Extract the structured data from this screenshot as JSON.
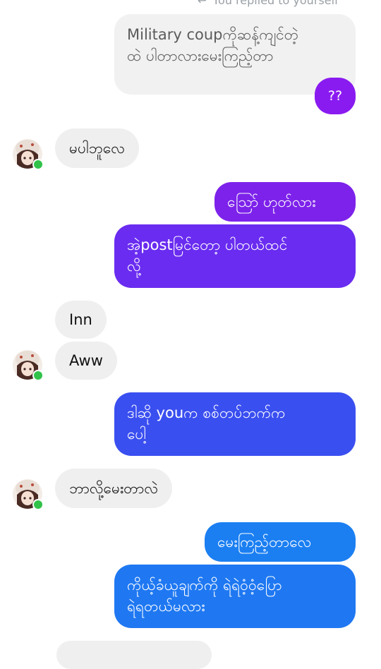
{
  "reply_hint": {
    "text": "You replied to yourself",
    "icon": "reply-arrow-icon"
  },
  "colors": {
    "purple_dark": "#7a1ee6",
    "purple_mid": "#6a2cf0",
    "blue": "#3a4ff0",
    "blue_light": "#1f78f2",
    "incoming": "#efefef",
    "online": "#31c24a"
  },
  "messages": [
    {
      "id": "quoted",
      "side": "right",
      "text_lines": [
        "Military coupကိုဆန့်ကျင်တဲ့",
        "ထဲ ပါတာလားမေးကြည့်တာ"
      ]
    },
    {
      "id": "qq",
      "side": "right",
      "text": "??"
    },
    {
      "id": "in1",
      "side": "left",
      "text": "မပါဘူလေ"
    },
    {
      "id": "out1",
      "side": "right",
      "text": "သြော် ဟုတ်လား"
    },
    {
      "id": "out2",
      "side": "right",
      "text_lines": [
        "အဲ့postမြင်တော့ ပါတယ်ထင်",
        "လို့"
      ]
    },
    {
      "id": "in2",
      "side": "left",
      "text": "Inn"
    },
    {
      "id": "in3",
      "side": "left",
      "text": "Aww"
    },
    {
      "id": "out3",
      "side": "right",
      "text_lines": [
        "ဒါဆို youက စစ်တပ်ဘက်က",
        "ပေါ့"
      ]
    },
    {
      "id": "in4",
      "side": "left",
      "text": "ဘာလို့မေးတာလဲ"
    },
    {
      "id": "out4",
      "side": "right",
      "text": "မေးကြည့်တာလေ"
    },
    {
      "id": "out5",
      "side": "right",
      "text_lines": [
        "ကိုယ့်ခံယူချက်ကို ရဲရဲဝံ့ဝံ့ပြော",
        "ရဲရတယ်မလား"
      ]
    }
  ]
}
